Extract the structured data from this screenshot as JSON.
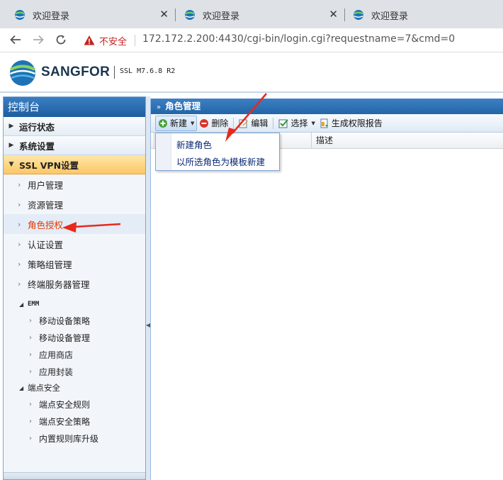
{
  "browser": {
    "tabs": [
      {
        "title": "欢迎登录",
        "close": "✕"
      },
      {
        "title": "欢迎登录",
        "close": "✕"
      },
      {
        "title": "欢迎登录"
      }
    ],
    "security_label": "不安全",
    "url": "172.172.2.200:4430/cgi-bin/login.cgi?requestname=7&cmd=0"
  },
  "header": {
    "logo_text": "SANGFOR",
    "version": "SSL M7.6.8 R2"
  },
  "sidebar": {
    "title": "控制台",
    "groups": [
      {
        "label": "运行状态"
      },
      {
        "label": "系统设置"
      },
      {
        "label": "SSL VPN设置"
      }
    ],
    "items": [
      {
        "label": "用户管理"
      },
      {
        "label": "资源管理"
      },
      {
        "label": "角色授权"
      },
      {
        "label": "认证设置"
      },
      {
        "label": "策略组管理"
      },
      {
        "label": "终端服务器管理"
      }
    ],
    "emm": {
      "label": "EMM",
      "items": [
        {
          "label": "移动设备策略"
        },
        {
          "label": "移动设备管理"
        },
        {
          "label": "应用商店"
        },
        {
          "label": "应用封装"
        }
      ]
    },
    "endpoint": {
      "label": "端点安全",
      "items": [
        {
          "label": "端点安全规则"
        },
        {
          "label": "端点安全策略"
        },
        {
          "label": "内置规则库升级"
        }
      ]
    }
  },
  "main": {
    "title": "角色管理",
    "toolbar": {
      "new": "新建",
      "delete": "删除",
      "edit": "编辑",
      "select": "选择",
      "report": "生成权限报告"
    },
    "columns": [
      "描述"
    ],
    "dropdown": {
      "items": [
        "新建角色",
        "以所选角色为模板新建"
      ]
    }
  },
  "colors": {
    "panel_header": "#2366a8",
    "selected_text": "#e63a00",
    "annotation_arrow": "#e8291c",
    "active_group": "#fcc766"
  }
}
